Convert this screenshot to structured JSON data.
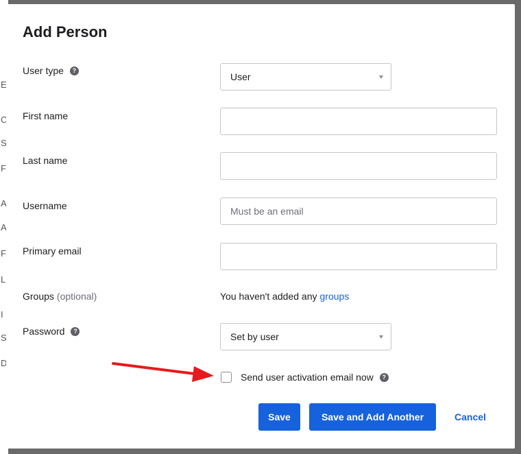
{
  "modal": {
    "title": "Add Person"
  },
  "form": {
    "user_type": {
      "label": "User type",
      "value": "User"
    },
    "first_name": {
      "label": "First name",
      "value": ""
    },
    "last_name": {
      "label": "Last name",
      "value": ""
    },
    "username": {
      "label": "Username",
      "value": "",
      "placeholder": "Must be an email"
    },
    "primary_email": {
      "label": "Primary email",
      "value": ""
    },
    "groups": {
      "label": "Groups",
      "optional": "(optional)",
      "empty_text": "You haven't added any",
      "link": "groups"
    },
    "password": {
      "label": "Password",
      "value": "Set by user"
    },
    "activation": {
      "label": "Send user activation email now",
      "checked": false
    }
  },
  "help_icon_glyph": "?",
  "buttons": {
    "save": "Save",
    "save_add_another": "Save and Add Another",
    "cancel": "Cancel"
  },
  "background_letters": [
    "E",
    "C",
    "S",
    "F",
    "A",
    "A",
    "F",
    "L",
    "I",
    "S",
    "D"
  ],
  "colors": {
    "primary": "#1662dd",
    "annotation_arrow": "#e8191c"
  },
  "icons": {
    "help": "help-icon",
    "dropdown": "chevron-down-icon",
    "annotation": "red-arrow-annotation"
  }
}
